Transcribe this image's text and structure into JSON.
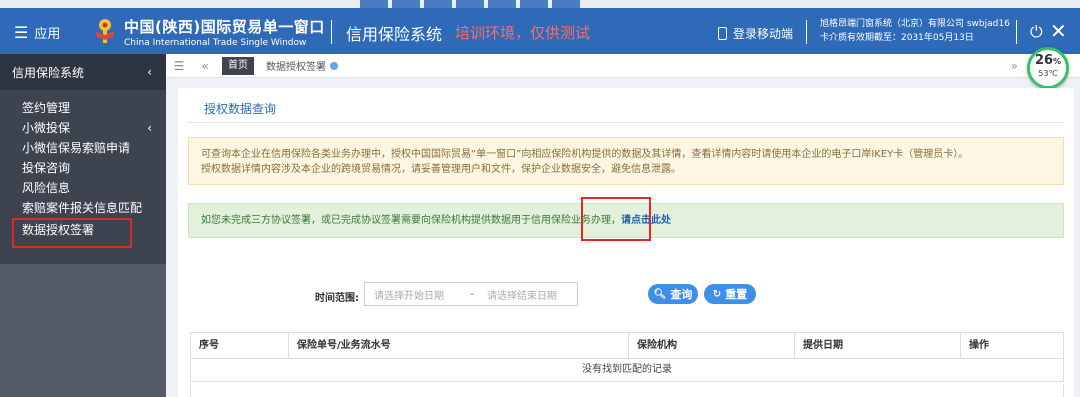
{
  "header": {
    "menu_label": "应用",
    "brand_cn": "中国(陕西)国际贸易单一窗口",
    "brand_en": "China International Trade Single Window",
    "system_name": "信用保险系统",
    "training_note": "培训环境，仅供测试",
    "mobile_login": "登录移动端",
    "company_line1": "旭格昂端门窗系统（北京）有限公司 swbjad16",
    "company_line2": "卡介质有效期截至：2031年05月13日"
  },
  "sidebar": {
    "title": "信用保险系统",
    "items": [
      {
        "label": "签约管理"
      },
      {
        "label": "小微投保"
      },
      {
        "label": "小微信保易索赔申请"
      },
      {
        "label": "投保咨询"
      },
      {
        "label": "风险信息"
      },
      {
        "label": "索赔案件报关信息匹配"
      },
      {
        "label": "数据授权签署"
      }
    ]
  },
  "tabs": {
    "home": "首页",
    "current": "数据授权签署"
  },
  "meter": {
    "percent": "26",
    "percent_unit": "%",
    "temperature": "53℃"
  },
  "main": {
    "section_title": "授权数据查询",
    "warning_line1": "可查询本企业在信用保险各类业务办理中，授权中国国际贸易“单一窗口”向相应保险机构提供的数据及其详情，查看详情内容时请使用本企业的电子口岸IKEY卡（管理员卡）。",
    "warning_line2": "授权数据详情内容涉及本企业的跨境贸易情况，请妥善管理用户和文件，保护企业数据安全，避免信息泄露。",
    "hint_text": "如您未完成三方协议签署，或已完成协议签署需要向保险机构提供数据用于信用保险业务办理，",
    "hint_link": "请点击此处",
    "filter_label": "时间范围:",
    "start_placeholder": "请选择开始日期",
    "date_dash": "-",
    "end_placeholder": "请选择结束日期",
    "query_button": "查询",
    "reset_button": "重置",
    "table_headers": [
      "序号",
      "保险单号/业务流水号",
      "保险机构",
      "提供日期",
      "操作"
    ],
    "empty_message": "没有找到匹配的记录"
  }
}
